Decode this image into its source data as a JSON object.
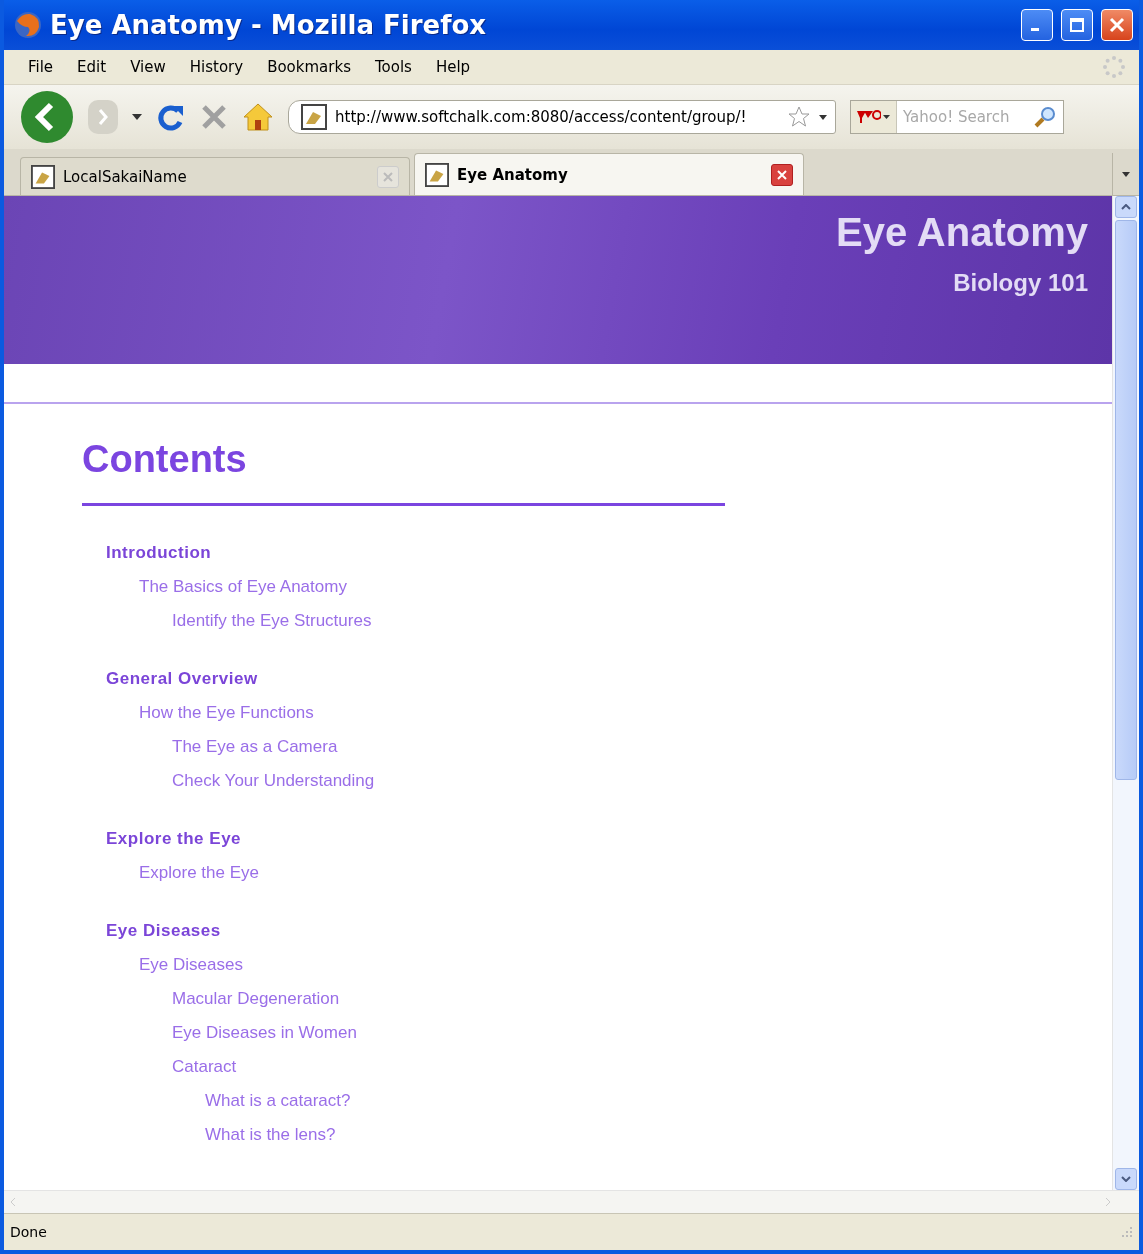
{
  "window": {
    "title": "Eye Anatomy - Mozilla Firefox"
  },
  "menu": [
    "File",
    "Edit",
    "View",
    "History",
    "Bookmarks",
    "Tools",
    "Help"
  ],
  "address": {
    "value": "http://www.softchalk.com:8080/access/content/group/!"
  },
  "search": {
    "placeholder": "Yahoo! Search"
  },
  "tabs": [
    {
      "label": "LocalSakaiName",
      "selected": false
    },
    {
      "label": "Eye Anatomy",
      "selected": true
    }
  ],
  "banner": {
    "title": "Eye Anatomy",
    "subtitle": "Biology 101"
  },
  "contents": {
    "heading": "Contents",
    "sections": [
      {
        "title": "Introduction",
        "children": [
          {
            "label": "The Basics of Eye Anatomy",
            "children": [
              {
                "label": "Identify the Eye Structures"
              }
            ]
          }
        ]
      },
      {
        "title": "General Overview",
        "children": [
          {
            "label": "How the Eye Functions",
            "children": [
              {
                "label": "The Eye as a Camera"
              },
              {
                "label": "Check Your Understanding"
              }
            ]
          }
        ]
      },
      {
        "title": "Explore the Eye",
        "children": [
          {
            "label": "Explore the Eye"
          }
        ]
      },
      {
        "title": "Eye Diseases",
        "children": [
          {
            "label": "Eye Diseases",
            "children": [
              {
                "label": "Macular Degeneration"
              },
              {
                "label": "Eye Diseases in Women"
              },
              {
                "label": "Cataract",
                "children": [
                  {
                    "label": "What is a cataract?"
                  },
                  {
                    "label": "What is the lens?"
                  }
                ]
              }
            ]
          }
        ]
      }
    ]
  },
  "status_bar": {
    "text": "Done"
  }
}
